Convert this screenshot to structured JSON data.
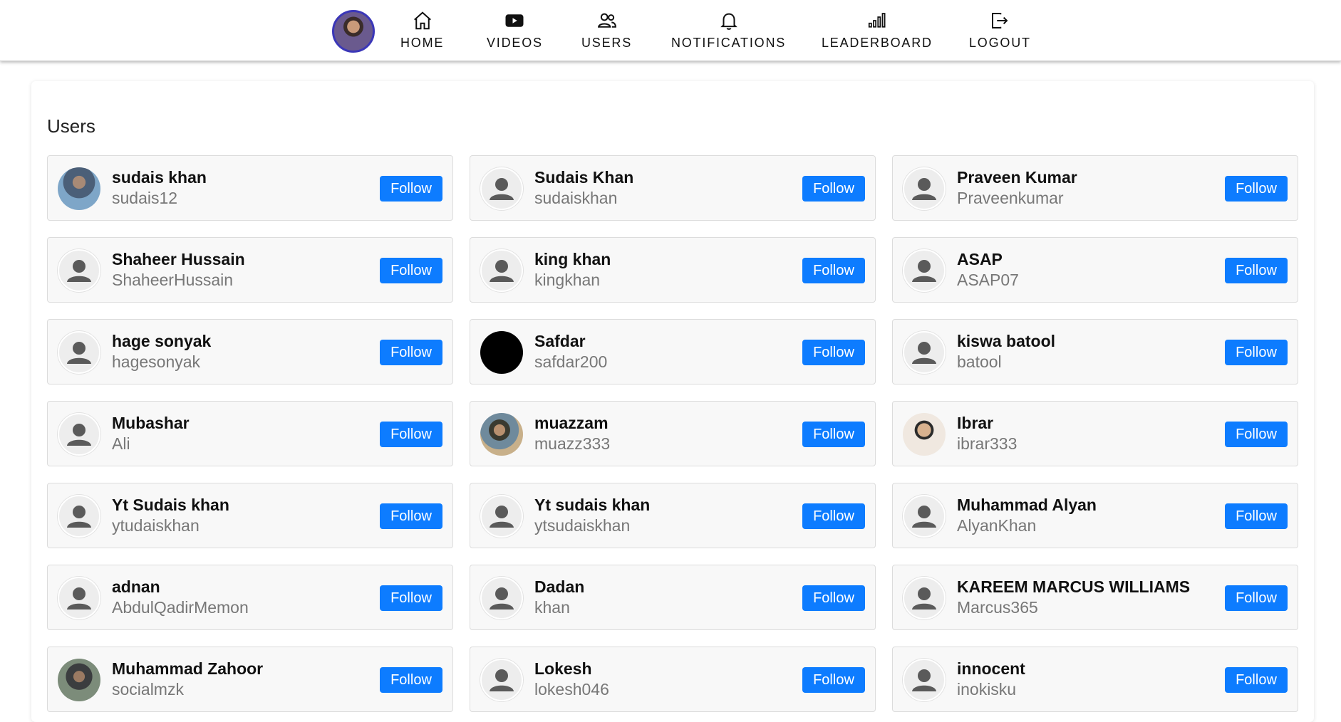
{
  "nav": {
    "avatar": "user-profile-photo",
    "items": [
      {
        "label": "HOME",
        "icon": "home-icon"
      },
      {
        "label": "VIDEOS",
        "icon": "youtube-play-icon"
      },
      {
        "label": "USERS",
        "icon": "users-icon"
      },
      {
        "label": "NOTIFICATIONS",
        "icon": "bell-icon"
      },
      {
        "label": "LEADERBOARD",
        "icon": "signal-bars-icon"
      },
      {
        "label": "LOGOUT",
        "icon": "logout-icon"
      }
    ]
  },
  "page": {
    "title": "Users",
    "follow_label": "Follow"
  },
  "users": [
    {
      "name": "sudais khan",
      "username": "sudais12",
      "avatar": "photo"
    },
    {
      "name": "Sudais Khan",
      "username": "sudaiskhan",
      "avatar": "default"
    },
    {
      "name": "Praveen Kumar",
      "username": "Praveenkumar",
      "avatar": "default"
    },
    {
      "name": "Shaheer Hussain",
      "username": "ShaheerHussain",
      "avatar": "default"
    },
    {
      "name": "king khan",
      "username": "kingkhan",
      "avatar": "default"
    },
    {
      "name": "ASAP",
      "username": "ASAP07",
      "avatar": "default"
    },
    {
      "name": "hage sonyak",
      "username": "hagesonyak",
      "avatar": "default"
    },
    {
      "name": "Safdar",
      "username": "safdar200",
      "avatar": "black"
    },
    {
      "name": "kiswa batool",
      "username": "batool",
      "avatar": "default"
    },
    {
      "name": "Mubashar",
      "username": "Ali",
      "avatar": "default"
    },
    {
      "name": "muazzam",
      "username": "muazz333",
      "avatar": "photo"
    },
    {
      "name": "Ibrar",
      "username": "ibrar333",
      "avatar": "photo"
    },
    {
      "name": "Yt Sudais khan",
      "username": "ytudaiskhan",
      "avatar": "default"
    },
    {
      "name": "Yt sudais khan",
      "username": "ytsudaiskhan",
      "avatar": "default"
    },
    {
      "name": "Muhammad Alyan",
      "username": "AlyanKhan",
      "avatar": "default"
    },
    {
      "name": "adnan",
      "username": "AbdulQadirMemon",
      "avatar": "default"
    },
    {
      "name": "Dadan",
      "username": "khan",
      "avatar": "default"
    },
    {
      "name": "KAREEM MARCUS WILLIAMS",
      "username": "Marcus365",
      "avatar": "default"
    },
    {
      "name": "Muhammad Zahoor",
      "username": "socialmzk",
      "avatar": "photo"
    },
    {
      "name": "Lokesh",
      "username": "lokesh046",
      "avatar": "default"
    },
    {
      "name": "innocent",
      "username": "inokisku",
      "avatar": "default"
    }
  ],
  "colors": {
    "accent": "#0d7cff",
    "card_bg": "#f8f8f8",
    "username_text": "#777777"
  }
}
